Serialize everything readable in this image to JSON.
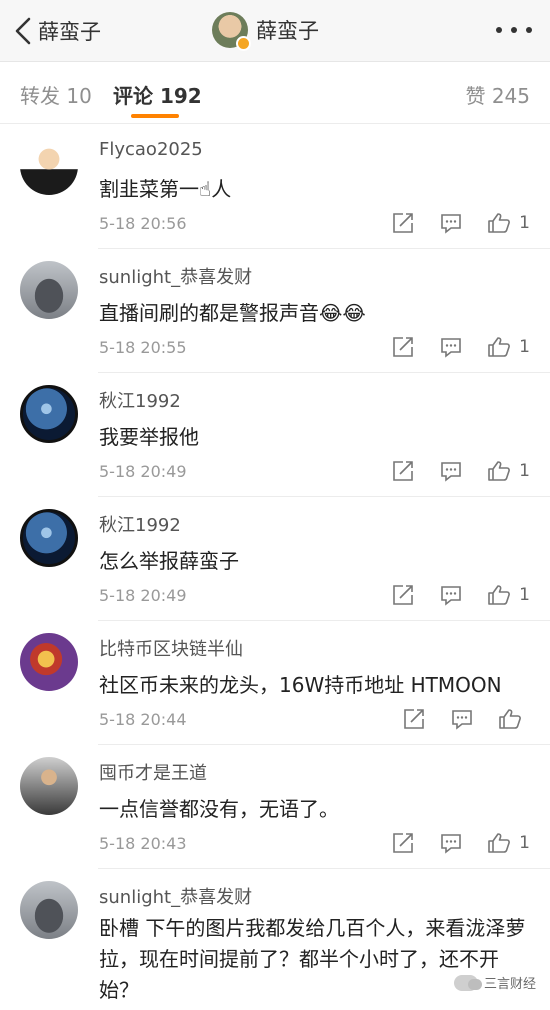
{
  "header": {
    "back_label": "薛蛮子",
    "title": "薛蛮子"
  },
  "tabs": [
    {
      "label": "转发 10"
    },
    {
      "label": "评论 192"
    },
    {
      "label": "赞 245"
    }
  ],
  "comments": [
    {
      "user": "Flycao2025",
      "text": "割韭菜第一",
      "emoji": "☝",
      "text_after": "人",
      "time": "5-18 20:56",
      "likes": "1"
    },
    {
      "user": "sunlight_恭喜发财",
      "text": "直播间刷的都是警报声音",
      "emoji": "😂😂",
      "time": "5-18 20:55",
      "likes": "1"
    },
    {
      "user": "秋江1992",
      "text": "我要举报他",
      "time": "5-18 20:49",
      "likes": "1"
    },
    {
      "user": "秋江1992",
      "text": "怎么举报薛蛮子",
      "time": "5-18 20:49",
      "likes": "1"
    },
    {
      "user": "比特币区块链半仙",
      "text": "社区币未来的龙头，16W持币地址 HTMOON",
      "time": "5-18 20:44",
      "likes": ""
    },
    {
      "user": "囤币才是王道",
      "text": "一点信誉都没有，无语了。",
      "time": "5-18 20:43",
      "likes": "1"
    },
    {
      "user": "sunlight_恭喜发财",
      "text": "卧槽 下午的图片我都发给几百个人，来看泷泽萝拉，现在时间提前了？都半个小时了，还不开始？"
    }
  ],
  "watermark": "三言财经",
  "icons": {
    "back": "chevron-left-icon",
    "more": "more-dots-icon",
    "share": "share-icon",
    "reply": "comment-icon",
    "like": "thumbs-up-icon"
  },
  "colors": {
    "accent": "#ff8200",
    "verified": "#f5a623"
  }
}
